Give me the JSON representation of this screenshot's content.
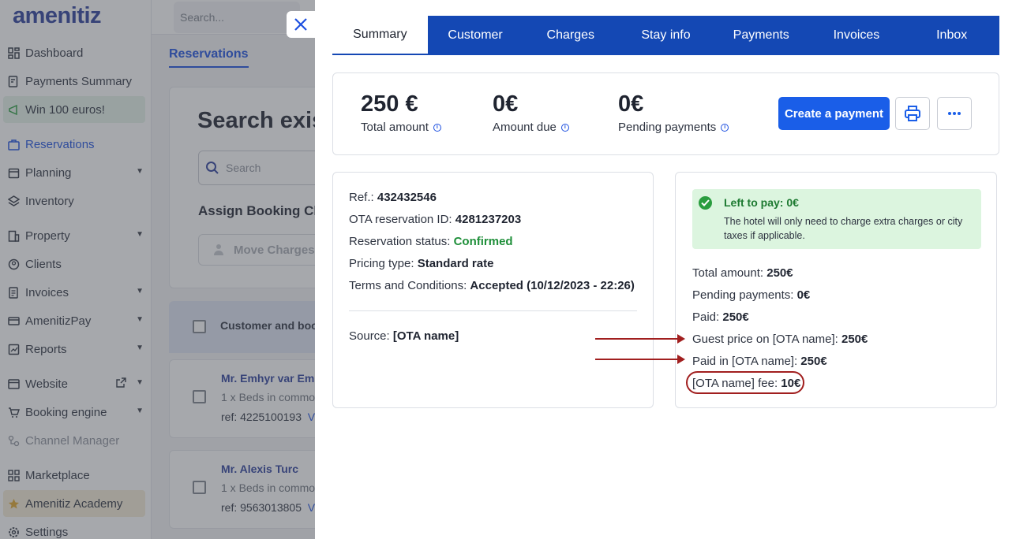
{
  "app": {
    "logo": "amenitiz",
    "search_placeholder": "Search...",
    "sidebar": [
      {
        "label": "Dashboard",
        "icon": "dashboard-icon"
      },
      {
        "label": "Payments Summary",
        "icon": "payments-icon"
      },
      {
        "label": "Win 100 euros!",
        "icon": "megaphone-icon"
      },
      {
        "label": "Reservations",
        "icon": "briefcase-icon"
      },
      {
        "label": "Planning",
        "icon": "calendar-icon"
      },
      {
        "label": "Inventory",
        "icon": "layers-icon"
      },
      {
        "label": "Property",
        "icon": "building-icon"
      },
      {
        "label": "Clients",
        "icon": "clients-icon"
      },
      {
        "label": "Invoices",
        "icon": "invoice-icon"
      },
      {
        "label": "AmenitizPay",
        "icon": "card-icon"
      },
      {
        "label": "Reports",
        "icon": "chart-icon"
      },
      {
        "label": "Website",
        "icon": "browser-icon"
      },
      {
        "label": "Booking engine",
        "icon": "cart-icon"
      },
      {
        "label": "Channel Manager",
        "icon": "channel-icon"
      },
      {
        "label": "Marketplace",
        "icon": "grid-icon"
      },
      {
        "label": "Amenitiz Academy",
        "icon": "academy-icon"
      },
      {
        "label": "Settings",
        "icon": "gear-icon"
      }
    ],
    "page_tab": "Reservations",
    "search_title": "Search exis",
    "search_input_placeholder": "Search",
    "assign_title": "Assign Booking Ch",
    "move_charges": "Move Charges",
    "table_header": "Customer and boo",
    "reservations": [
      {
        "name": "Mr. Emhyr var Em",
        "room": "1 x Beds in commo",
        "ref": "ref: 4225100193",
        "link": "V"
      },
      {
        "name": "Mr. Alexis Turc",
        "room": "1 x Beds in commo",
        "ref": "ref: 9563013805",
        "link": "V"
      }
    ]
  },
  "drawer": {
    "tabs": [
      "Summary",
      "Customer",
      "Charges",
      "Stay info",
      "Payments",
      "Invoices",
      "Inbox"
    ],
    "active_tab": "Summary",
    "summary": {
      "total_amount": {
        "value": "250 €",
        "label": "Total amount"
      },
      "amount_due": {
        "value": "0€",
        "label": "Amount due"
      },
      "pending_payments": {
        "value": "0€",
        "label": "Pending payments"
      },
      "create_payment": "Create a payment"
    },
    "reservation_info": {
      "ref_label": "Ref.:",
      "ref_value": "432432546",
      "ota_id_label": "OTA reservation ID:",
      "ota_id_value": "4281237203",
      "status_label": "Reservation status:",
      "status_value": "Confirmed",
      "pricing_label": "Pricing type:",
      "pricing_value": "Standard rate",
      "terms_label": "Terms and Conditions:",
      "terms_value": "Accepted (10/12/2023 - 22:26)",
      "source_label": "Source:",
      "source_value": "[OTA name]"
    },
    "payment_info": {
      "alert_title": "Left to pay: 0€",
      "alert_text": "The hotel will only need to charge extra charges or city taxes if applicable.",
      "total_label": "Total amount:",
      "total_value": "250€",
      "pending_label": "Pending payments:",
      "pending_value": "0€",
      "paid_label": "Paid:",
      "paid_value": "250€",
      "guest_price_label": "Guest price on [OTA name]:",
      "guest_price_value": "250€",
      "paid_in_label": "Paid in [OTA name]:",
      "paid_in_value": "250€",
      "fee_label": "[OTA name] fee:",
      "fee_value": "10€"
    },
    "colors": {
      "tab_bar": "#1448b4",
      "primary_button": "#1a5ee8",
      "confirmed": "#1f8f3a",
      "annotation": "#a11f1f"
    }
  }
}
